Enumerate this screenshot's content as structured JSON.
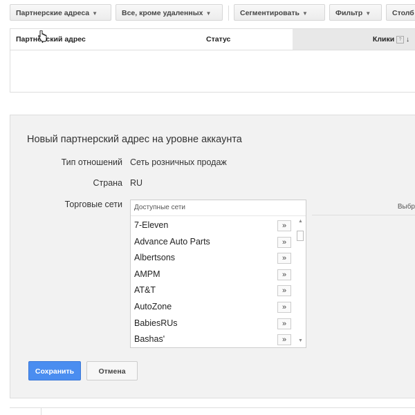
{
  "toolbar": {
    "partner_addresses": "Партнерские адреса",
    "all_except_deleted": "Все, кроме удаленных",
    "segment": "Сегментировать",
    "filter": "Фильтр",
    "columns": "Столб"
  },
  "table": {
    "col_partner_address": "Партнерский адрес",
    "col_status": "Статус",
    "col_clicks": "Клики",
    "help_glyph": "?",
    "sort_glyph": "↓"
  },
  "form": {
    "title": "Новый партнерский адрес на уровне аккаунта",
    "relation_label": "Тип отношений",
    "relation_value": "Сеть розничных продаж",
    "country_label": "Страна",
    "country_value": "RU",
    "networks_label": "Торговые сети",
    "available_header": "Доступные сети",
    "selected_header": "Выбр",
    "add_glyph": "»",
    "networks": [
      "7-Eleven",
      "Advance Auto Parts",
      "Albertsons",
      "AMPM",
      "AT&T",
      "AutoZone",
      "BabiesRUs",
      "Bashas'"
    ],
    "save": "Сохранить",
    "cancel": "Отмена"
  },
  "colors": {
    "primary": "#4a8df0",
    "panel_bg": "#f2f2f2"
  }
}
